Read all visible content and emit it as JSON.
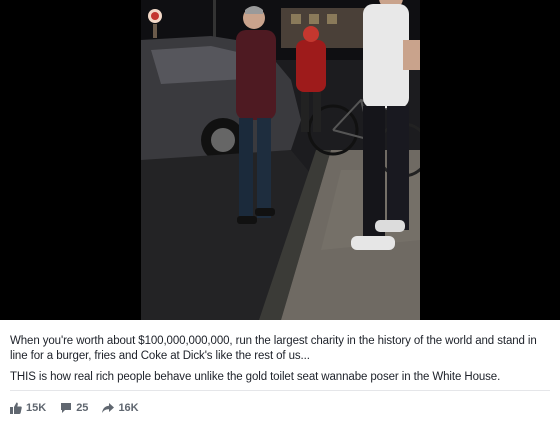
{
  "post": {
    "caption_line1": "When you're worth about $100,000,000,000, run the largest charity in the history of the world and stand in line for a burger, fries and Coke at Dick's like the rest of us...",
    "caption_line2": "THIS is how real rich people behave unlike the gold toilet seat wannabe poser in the White House.",
    "photo_alt": "Two men standing in line on a sidewalk at night next to parked cars and a bicycle"
  },
  "actions": {
    "likes": "15K",
    "comments": "25",
    "shares": "16K"
  },
  "colors": {
    "text": "#1d2129",
    "muted": "#606770",
    "divider": "#e5e6e9",
    "photo_border": "#000000"
  }
}
